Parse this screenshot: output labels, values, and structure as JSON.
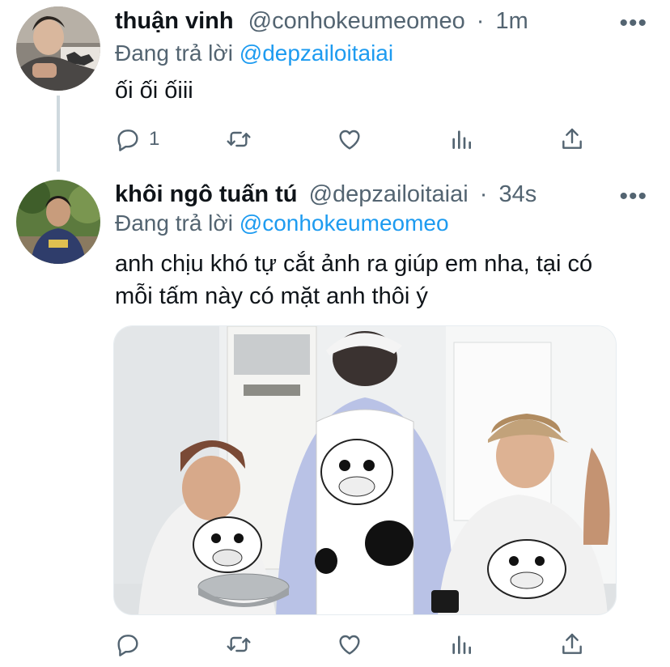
{
  "tweets": [
    {
      "name": "thuận vinh",
      "handle": "@conhokeumeomeo",
      "separator": "·",
      "time": "1m",
      "reply_prefix": "Đang trả lời",
      "reply_to": "@depzailoitaiai",
      "text": "ối ối ốiii",
      "reply_count": "1",
      "avatar": "profile-photo-boy-lying",
      "icons": [
        "reply-icon",
        "retweet-icon",
        "like-icon",
        "stats-icon",
        "share-icon",
        "more-icon"
      ]
    },
    {
      "name": "khôi ngô tuấn tú",
      "handle": "@depzailoitaiai",
      "separator": "·",
      "time": "34s",
      "reply_prefix": "Đang trả lời",
      "reply_to": "@conhokeumeomeo",
      "text_line1": "anh chịu khó tự cắt ảnh ra giúp em nha, tại có",
      "text_line2": "mỗi tấm này có mặt anh thôi ý",
      "avatar": "profile-photo-boy-sweater",
      "media": "photo-three-boys-cow-aprons-cooking",
      "icons": [
        "reply-icon",
        "retweet-icon",
        "like-icon",
        "stats-icon",
        "share-icon",
        "more-icon"
      ]
    }
  ],
  "more_glyph": "•••",
  "colors": {
    "text": "#0f1419",
    "secondary": "#536471",
    "link": "#1d9bf0",
    "thread_line": "#cfd9de"
  }
}
